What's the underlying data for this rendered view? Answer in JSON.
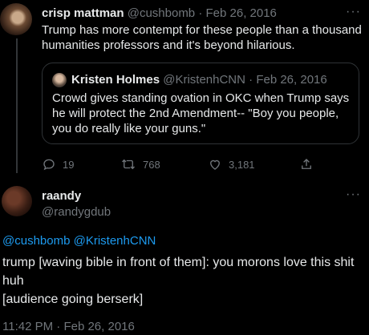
{
  "tweet": {
    "author_name": "crisp mattman",
    "author_handle": "@cushbomb",
    "separator": "·",
    "date": "Feb 26, 2016",
    "text": "Trump has more contempt for these people than a thousand humanities professors and it's beyond hilarious.",
    "quote": {
      "author_name": "Kristen Holmes",
      "author_handle": "@KristenhCNN",
      "separator": "·",
      "date": "Feb 26, 2016",
      "text": "Crowd gives standing ovation in OKC when Trump says he will protect the 2nd Amendment-- \"Boy you people, you do really like your guns.\""
    },
    "actions": {
      "replies": "19",
      "retweets": "768",
      "likes": "3,181"
    }
  },
  "reply": {
    "author_name": "raandy",
    "author_handle": "@randygdub",
    "mentions": "@cushbomb @KristenhCNN",
    "text_line1": "trump [waving bible in front of them]: you morons love this shit huh",
    "text_line2": "[audience going berserk]",
    "time": "11:42 PM",
    "separator": "·",
    "date": "Feb 26, 2016"
  },
  "more_label": "···"
}
